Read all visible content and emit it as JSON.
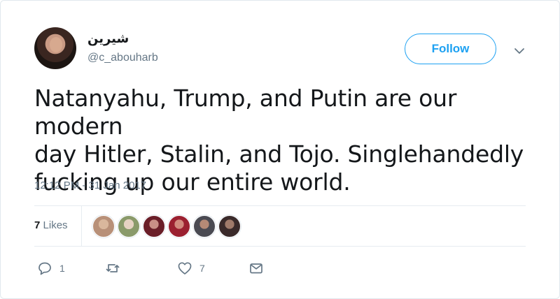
{
  "user": {
    "display_name": "شيرين",
    "handle": "@c_abouharb",
    "avatar": "profile-photo"
  },
  "follow_label": "Follow",
  "tweet": {
    "lines": [
      "Natanyahu, Trump, and Putin are our modern",
      "day Hitler, Stalin, and Tojo. Singlehandedly",
      "fucking up our entire world."
    ],
    "timestamp": "12:12 PM - 31 Jan 2017"
  },
  "likes": {
    "count": "7",
    "label": "Likes",
    "avatars": [
      {
        "color": "#b89078"
      },
      {
        "color": "#8a9a6a"
      },
      {
        "color": "#6a1e28"
      },
      {
        "color": "#9b2030"
      },
      {
        "color": "#4a4a52"
      },
      {
        "color": "#3a2a2a"
      }
    ]
  },
  "actions": {
    "reply_count": "1",
    "retweet_count": "",
    "like_count": "7"
  },
  "colors": {
    "accent": "#1da1f2",
    "muted": "#657786",
    "text": "#14171a"
  }
}
